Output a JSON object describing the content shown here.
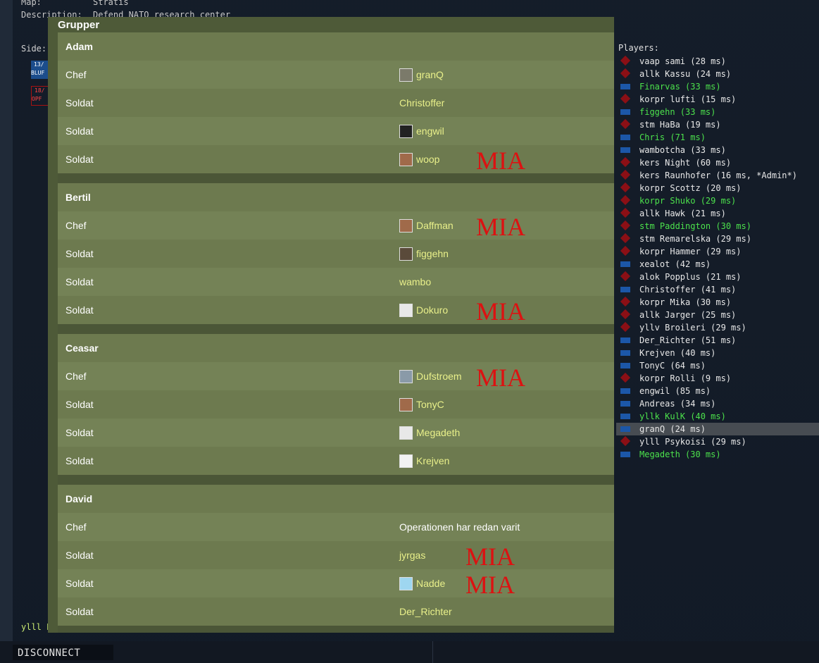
{
  "mission": {
    "map_label": "Map:",
    "map_value": "Stratis",
    "description_label": "Description:",
    "description_value": "Defend NATO research center",
    "side_label": "Side:",
    "side_blue_count": "13/",
    "side_blue_name": "BLUF",
    "side_red_count": "18/",
    "side_red_name": "OPF"
  },
  "footer": {
    "player_name_partial": "ylll Ps",
    "disconnect_label": "DISCONNECT"
  },
  "dialog": {
    "title": "Grupper",
    "mia_label": "MIA",
    "groups": [
      {
        "name": "Adam",
        "members": [
          {
            "role": "Chef",
            "player": "granQ",
            "avatar": "vehicle-avatar",
            "mia": false
          },
          {
            "role": "Soldat",
            "player": "Christoffer",
            "avatar": "",
            "mia": false
          },
          {
            "role": "Soldat",
            "player": "engwil",
            "avatar": "figure-avatar",
            "mia": false
          },
          {
            "role": "Soldat",
            "player": "woop",
            "avatar": "face-avatar",
            "mia": true
          }
        ]
      },
      {
        "name": "Bertil",
        "members": [
          {
            "role": "Chef",
            "player": "Daffman",
            "avatar": "face-avatar",
            "mia": true
          },
          {
            "role": "Soldat",
            "player": "figgehn",
            "avatar": "soldier-avatar",
            "mia": false
          },
          {
            "role": "Soldat",
            "player": "wambo",
            "avatar": "",
            "mia": false
          },
          {
            "role": "Soldat",
            "player": "Dokuro",
            "avatar": "skull-avatar",
            "mia": true
          }
        ]
      },
      {
        "name": "Ceasar",
        "members": [
          {
            "role": "Chef",
            "player": "Dufstroem",
            "avatar": "scene-avatar",
            "mia": true
          },
          {
            "role": "Soldat",
            "player": "TonyC",
            "avatar": "face-avatar",
            "mia": false
          },
          {
            "role": "Soldat",
            "player": "Megadeth",
            "avatar": "skull-avatar",
            "mia": false
          },
          {
            "role": "Soldat",
            "player": "Krejven",
            "avatar": "sketch-avatar",
            "mia": false
          }
        ]
      },
      {
        "name": "David",
        "members": [
          {
            "role": "Chef",
            "player": "Operationen har redan varit",
            "avatar": "",
            "mia": false,
            "white": true
          },
          {
            "role": "Soldat",
            "player": "jyrgas",
            "avatar": "",
            "mia": true
          },
          {
            "role": "Soldat",
            "player": "Nadde",
            "avatar": "ghost-avatar",
            "mia": true
          },
          {
            "role": "Soldat",
            "player": "Der_Richter",
            "avatar": "",
            "mia": false
          }
        ]
      }
    ]
  },
  "players": {
    "title": "Players:",
    "items": [
      {
        "text": "vaap sami (28 ms)",
        "side": "opfor",
        "green": false
      },
      {
        "text": "allk Kassu (24 ms)",
        "side": "opfor",
        "green": false
      },
      {
        "text": "Finarvas (33 ms)",
        "side": "blufor",
        "green": true
      },
      {
        "text": "korpr lufti (15 ms)",
        "side": "opfor",
        "green": false
      },
      {
        "text": "figgehn (33 ms)",
        "side": "blufor",
        "green": true
      },
      {
        "text": "stm HaBa (19 ms)",
        "side": "opfor",
        "green": false
      },
      {
        "text": "Chris (71 ms)",
        "side": "blufor",
        "green": true
      },
      {
        "text": "wambotcha (33 ms)",
        "side": "blufor",
        "green": false
      },
      {
        "text": "kers Night (60 ms)",
        "side": "opfor",
        "green": false
      },
      {
        "text": "kers Raunhofer (16 ms, *Admin*)",
        "side": "opfor",
        "green": false
      },
      {
        "text": "korpr Scottz (20 ms)",
        "side": "opfor",
        "green": false
      },
      {
        "text": "korpr Shuko (29 ms)",
        "side": "opfor",
        "green": true
      },
      {
        "text": "allk Hawk (21 ms)",
        "side": "opfor",
        "green": false
      },
      {
        "text": "stm Paddington (30 ms)",
        "side": "opfor",
        "green": true
      },
      {
        "text": "stm Remarelska (29 ms)",
        "side": "opfor",
        "green": false
      },
      {
        "text": "korpr Hammer (29 ms)",
        "side": "opfor",
        "green": false
      },
      {
        "text": "xealot (42 ms)",
        "side": "blufor",
        "green": false
      },
      {
        "text": "alok Popplus (21 ms)",
        "side": "opfor",
        "green": false
      },
      {
        "text": "Christoffer (41 ms)",
        "side": "blufor",
        "green": false
      },
      {
        "text": "korpr Mika (30 ms)",
        "side": "opfor",
        "green": false
      },
      {
        "text": "allk Jarger (25 ms)",
        "side": "opfor",
        "green": false
      },
      {
        "text": "yllv Broileri (29 ms)",
        "side": "opfor",
        "green": false
      },
      {
        "text": "Der_Richter (51 ms)",
        "side": "blufor",
        "green": false
      },
      {
        "text": "Krejven (40 ms)",
        "side": "blufor",
        "green": false
      },
      {
        "text": "TonyC (64 ms)",
        "side": "blufor",
        "green": false
      },
      {
        "text": "korpr Rolli (9 ms)",
        "side": "opfor",
        "green": false
      },
      {
        "text": "engwil (85 ms)",
        "side": "blufor",
        "green": false
      },
      {
        "text": "Andreas (34 ms)",
        "side": "blufor",
        "green": false
      },
      {
        "text": "yllk KulK (40 ms)",
        "side": "blufor",
        "green": true
      },
      {
        "text": "granQ (24 ms)",
        "side": "blufor",
        "green": false,
        "selected": true
      },
      {
        "text": "ylll Psykoisi (29 ms)",
        "side": "opfor",
        "green": false
      },
      {
        "text": "Megadeth (30 ms)",
        "side": "blufor",
        "green": true
      }
    ]
  },
  "colors": {
    "blufor": "#1c57a8",
    "opfor": "#8b0f15",
    "mia": "#dd1111",
    "player_name": "#e9f08a",
    "ping_green": "#4ce24c"
  }
}
